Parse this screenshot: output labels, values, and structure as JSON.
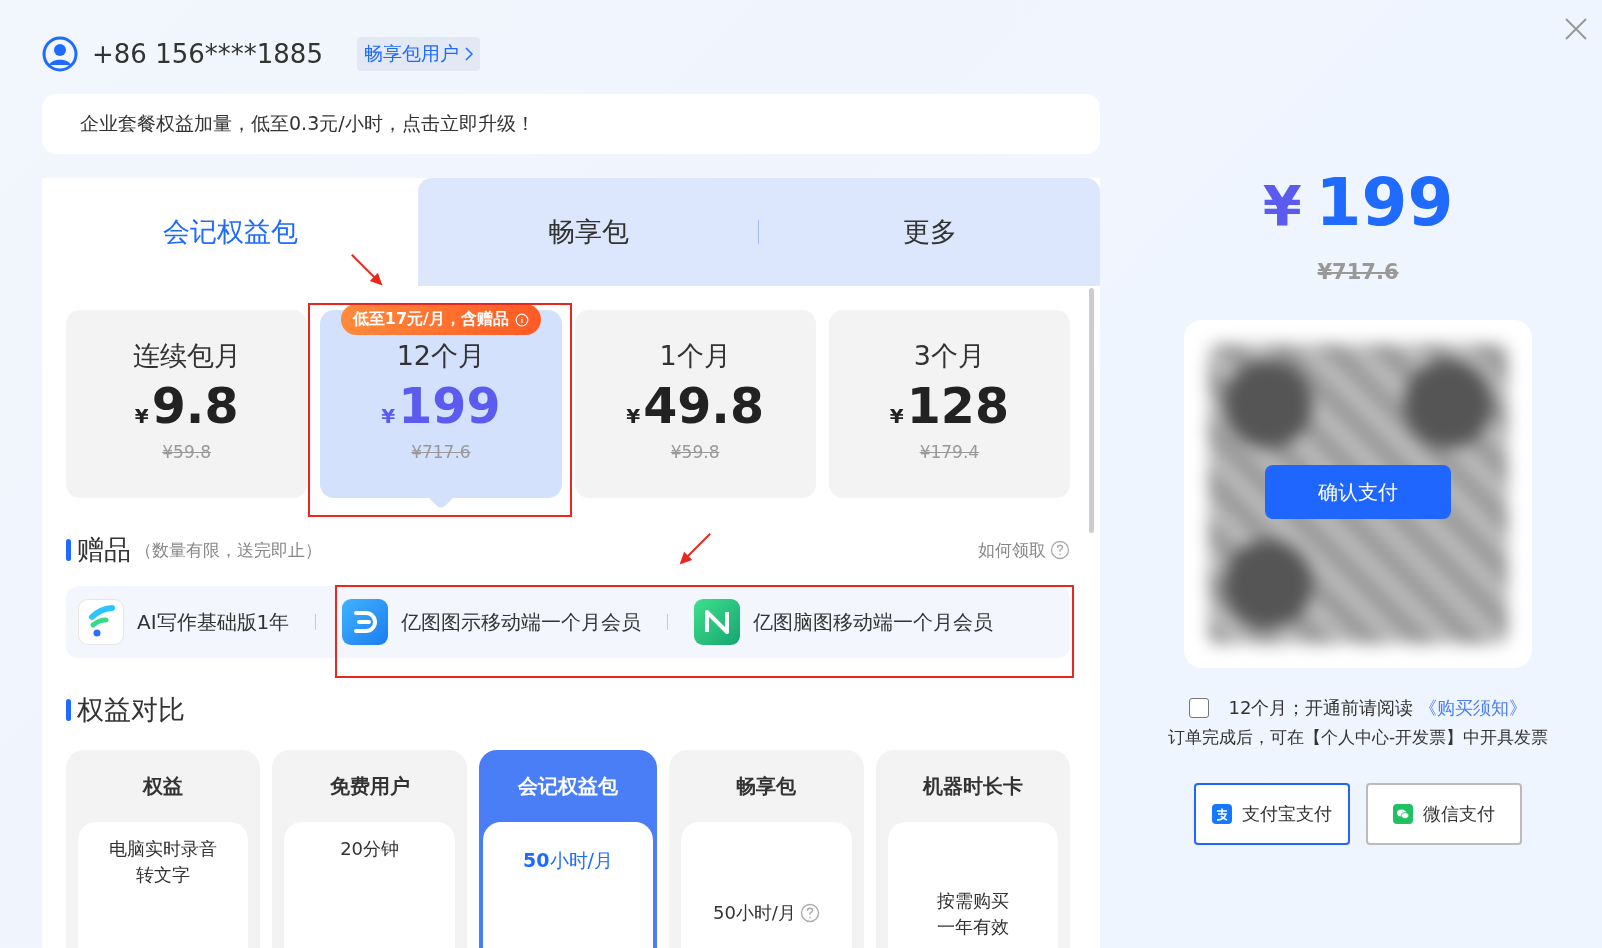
{
  "account": {
    "phone": "+86 156****1885",
    "badge": "畅享包用户"
  },
  "banner": "企业套餐权益加量，低至0.3元/小时，点击立即升级！",
  "tabs": [
    {
      "label": "会记权益包",
      "selected": true
    },
    {
      "label": "畅享包",
      "selected": false
    },
    {
      "label": "更多",
      "selected": false
    }
  ],
  "plans": [
    {
      "name": "连续包月",
      "currency": "¥",
      "price": "9.8",
      "original": "¥59.8",
      "selected": false
    },
    {
      "name": "12个月",
      "currency": "¥",
      "price": "199",
      "original": "¥717.6",
      "selected": true,
      "tag": "低至17元/月，含赠品"
    },
    {
      "name": "1个月",
      "currency": "¥",
      "price": "49.8",
      "original": "¥59.8",
      "selected": false
    },
    {
      "name": "3个月",
      "currency": "¥",
      "price": "128",
      "original": "¥179.4",
      "selected": false
    }
  ],
  "gifts": {
    "title": "赠品",
    "note": "（数量有限，送完即止）",
    "help": "如何领取",
    "items": [
      {
        "label": "AI写作基础版1年",
        "kind": "writer"
      },
      {
        "label": "亿图图示移动端一个月会员",
        "kind": "diagram"
      },
      {
        "label": "亿图脑图移动端一个月会员",
        "kind": "mindmap"
      }
    ]
  },
  "compare": {
    "title": "权益对比",
    "columns": [
      {
        "header": "权益",
        "selected": false,
        "lines": [
          "电脑实时录音",
          "转文字"
        ]
      },
      {
        "header": "免费用户",
        "selected": false,
        "lines": [
          "20分钟"
        ]
      },
      {
        "header": "会记权益包",
        "selected": true,
        "lines": [
          "**50**小时/月"
        ]
      },
      {
        "header": "畅享包",
        "selected": false,
        "lines": [
          "50小时/月"
        ],
        "help": true
      },
      {
        "header": "机器时长卡",
        "selected": false,
        "lines": [
          "按需购买",
          "一年有效"
        ]
      }
    ]
  },
  "checkout": {
    "currency": "¥",
    "price": "199",
    "original": "¥717.6",
    "confirm": "确认支付",
    "agree": {
      "checked": false,
      "text": "12个月；开通前请阅读",
      "link": "《购买须知》"
    },
    "note": "订单完成后，可在【个人中心-开发票】中开具发票",
    "methods": [
      {
        "label": "支付宝支付",
        "kind": "alipay",
        "selected": true
      },
      {
        "label": "微信支付",
        "kind": "wechat",
        "selected": false
      }
    ]
  }
}
